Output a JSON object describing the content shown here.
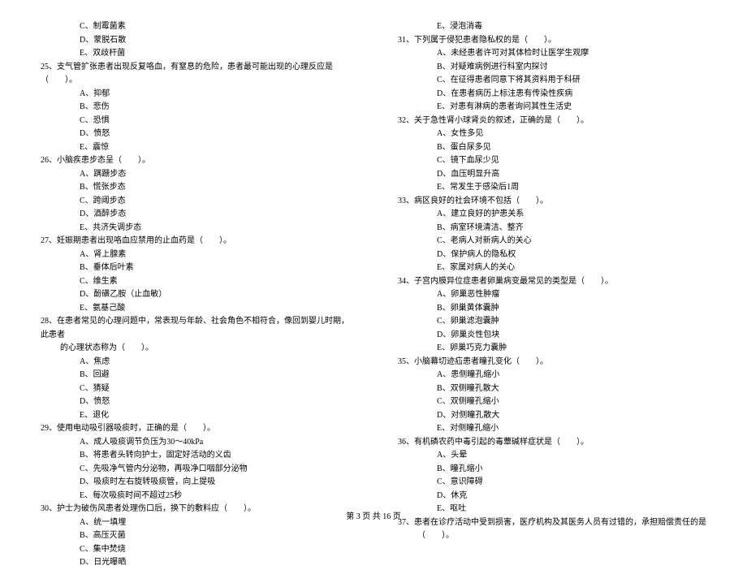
{
  "left": {
    "pre_opts": [
      "C、制霉菌素",
      "D、蒙脱石散",
      "E、双歧杆菌"
    ],
    "q25": "25、支气管扩张患者出现反复咯血，有窒息的危险，患者最可能出现的心理反应是（　　）。",
    "q25_opts": [
      "A、抑郁",
      "B、悲伤",
      "C、恐惧",
      "D、愤怒",
      "E、震惊"
    ],
    "q26": "26、小脑疾患步态呈（　　）。",
    "q26_opts": [
      "A、蹒跚步态",
      "B、慌张步态",
      "C、跨阈步态",
      "D、酒醉步态",
      "E、共济失调步态"
    ],
    "q27": "27、妊娠期患者出现咯血应禁用的止血药是（　　）。",
    "q27_opts": [
      "A、肾上腺素",
      "B、垂体后叶素",
      "C、维生素",
      "D、酚磺乙胺（止血敏）",
      "E、氨基己酸"
    ],
    "q28": "28、在患者常见的心理问题中，常表现与年龄、社会角色不相符合，像回到婴儿时期，此患者",
    "q28_line2": "的心理状态称为（　　）。",
    "q28_opts": [
      "A、焦虑",
      "B、回避",
      "C、猜疑",
      "D、愤怒",
      "E、退化"
    ],
    "q29": "29、使用电动吸引器吸痰时，正确的是（　　）。",
    "q29_opts": [
      "A、成人吸痰调节负压为30～40kPa",
      "B、将患者头转向护士，固定好活动的义齿",
      "C、先吸净气管内分泌物，再吸净口咽部分泌物",
      "D、吸痰时左右旋转吸痰管，向上提吸",
      "E、每次吸痰时间不超过25秒"
    ],
    "q30": "30、护士为破伤风患者处理伤口后，换下的敷料应（　　）。",
    "q30_opts": [
      "A、统一填埋",
      "B、高压灭菌",
      "C、集中焚烧",
      "D、日光曝晒"
    ]
  },
  "right": {
    "pre_opts": [
      "E、浸泡消毒"
    ],
    "q31": "31、下列属于侵犯患者隐私权的是（　　）。",
    "q31_opts": [
      "A、未经患者许可对其体检时让医学生观摩",
      "B、对疑难病例进行科室内探讨",
      "C、在征得患者同意下将其资料用于科研",
      "D、在患者病历上标注患有传染性疾病",
      "E、对患有淋病的患者询问其性生活史"
    ],
    "q32": "32、关于急性肾小球肾炎的叙述，正确的是（　　）。",
    "q32_opts": [
      "A、女性多见",
      "B、蛋白尿多见",
      "C、镜下血尿少见",
      "D、血压明显升高",
      "E、常发生于感染后1周"
    ],
    "q33": "33、病区良好的社会环境不包括（　　）。",
    "q33_opts": [
      "A、建立良好的护患关系",
      "B、病室环境清洁、整齐",
      "C、老病人对新病人的关心",
      "D、保护病人的隐私权",
      "E、家属对病人的关心"
    ],
    "q34": "34、子宫内膜异位症患者卵巢病变最常见的类型是（　　）。",
    "q34_opts": [
      "A、卵巢恶性肿瘤",
      "B、卵巢黄体囊肿",
      "C、卵巢滤泡囊肿",
      "D、卵巢炎性包块",
      "E、卵巢巧克力囊肿"
    ],
    "q35": "35、小脑幕切迹疝患者瞳孔变化（　　）。",
    "q35_opts": [
      "A、患侧瞳孔缩小",
      "B、双侧瞳孔散大",
      "C、双侧瞳孔缩小",
      "D、对侧瞳孔散大",
      "E、对侧瞳孔缩小"
    ],
    "q36": "36、有机磷农药中毒引起的毒蕈碱样症状是（　　）。",
    "q36_opts": [
      "A、头晕",
      "B、瞳孔缩小",
      "C、意识障碍",
      "D、休克",
      "E、呕吐"
    ],
    "q37": "37、患者在诊疗活动中受到损害，医疗机构及其医务人员有过错的，承担赔偿责任的是",
    "q37_line2": "（　　）。"
  },
  "footer": "第 3 页 共 16 页"
}
